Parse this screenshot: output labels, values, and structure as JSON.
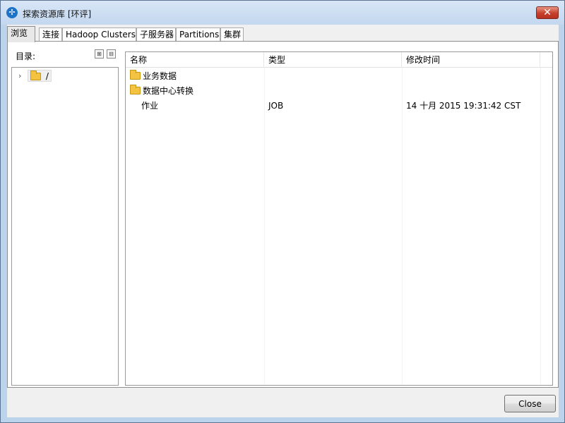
{
  "window": {
    "title": "探索资源库 [环评]",
    "close_symbol": "✕"
  },
  "tabs": [
    {
      "label": "浏览",
      "active": true
    },
    {
      "label": "连接"
    },
    {
      "label": "Hadoop Clusters"
    },
    {
      "label": "子服务器"
    },
    {
      "label": "Partitions"
    },
    {
      "label": "集群"
    }
  ],
  "browser": {
    "directory_label": "目录:",
    "tree": {
      "root": {
        "label": "/",
        "expander": "›",
        "icon": "folder-icon"
      }
    },
    "list": {
      "columns": [
        "名称",
        "类型",
        "修改时间"
      ],
      "rows": [
        {
          "name": "业务数据",
          "type": "",
          "modified": "",
          "icon": "folder-icon"
        },
        {
          "name": "数据中心转换",
          "type": "",
          "modified": "",
          "icon": "folder-icon"
        },
        {
          "name": "作业",
          "type": "JOB",
          "modified": "14 十月 2015 19:31:42 CST",
          "icon": ""
        }
      ]
    }
  },
  "footer": {
    "close_label": "Close"
  },
  "colors": {
    "title_bg": "#c3d7ef",
    "close_btn_red": "#c7402c",
    "folder_yellow": "#f5c342"
  }
}
